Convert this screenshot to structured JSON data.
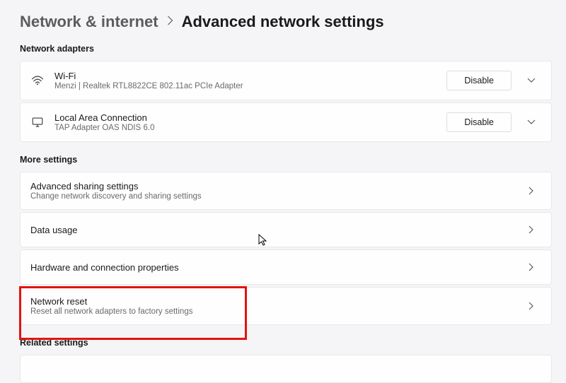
{
  "breadcrumb": {
    "parent": "Network & internet",
    "current": "Advanced network settings"
  },
  "sections": {
    "adapters_label": "Network adapters",
    "more_label": "More settings",
    "related_label": "Related settings"
  },
  "adapters": [
    {
      "title": "Wi-Fi",
      "sub": "Menzi | Realtek RTL8822CE 802.11ac PCIe Adapter",
      "action": "Disable",
      "icon": "wifi"
    },
    {
      "title": "Local Area Connection",
      "sub": "TAP Adapter OAS NDIS 6.0",
      "action": "Disable",
      "icon": "monitor"
    }
  ],
  "more": [
    {
      "title": "Advanced sharing settings",
      "sub": "Change network discovery and sharing settings"
    },
    {
      "title": "Data usage",
      "sub": ""
    },
    {
      "title": "Hardware and connection properties",
      "sub": ""
    },
    {
      "title": "Network reset",
      "sub": "Reset all network adapters to factory settings"
    }
  ],
  "highlight_index": 3
}
